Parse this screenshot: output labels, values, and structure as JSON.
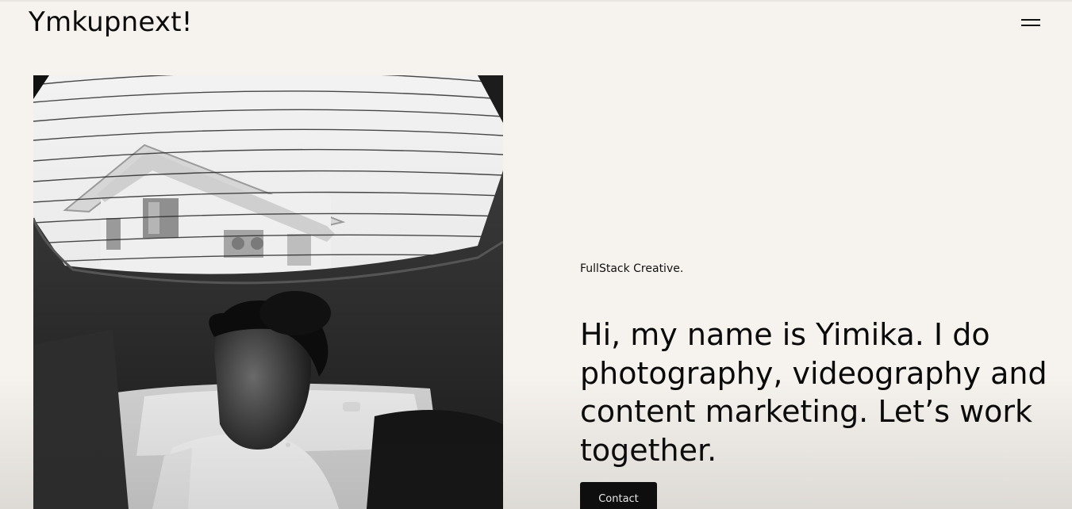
{
  "header": {
    "logo_text": "Ymkupnext!",
    "menu_icon": "hamburger-menu-icon"
  },
  "hero": {
    "image_alt": "Black and white photo of a man in a car beneath a sunroof",
    "tagline": "FullStack Creative.",
    "intro": "Hi, my name is Yimika. I do photography, videography and content marketing. Let’s work together.",
    "contact_label": "Contact"
  },
  "colors": {
    "background": "#f6f3ee",
    "text": "#0a0a0a",
    "button_bg": "#0b0b0b",
    "button_text": "#ffffff"
  }
}
